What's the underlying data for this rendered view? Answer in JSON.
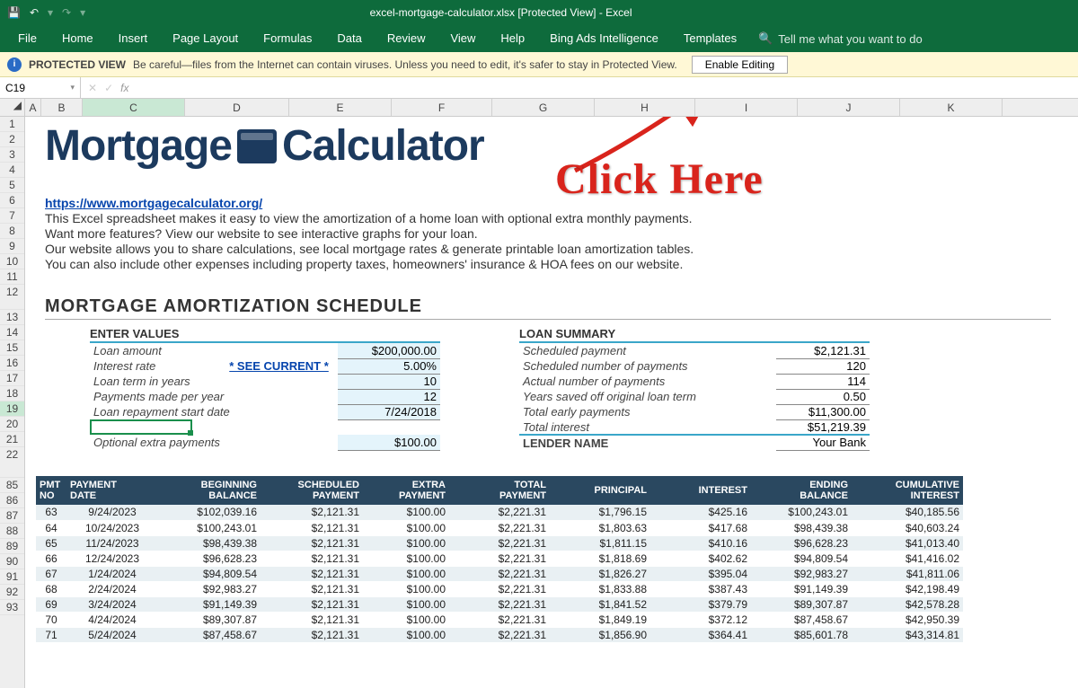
{
  "title": "excel-mortgage-calculator.xlsx  [Protected View]  -  Excel",
  "qat": {
    "save": "💾",
    "undo": "↶",
    "redo": "↷"
  },
  "ribbon": [
    "File",
    "Home",
    "Insert",
    "Page Layout",
    "Formulas",
    "Data",
    "Review",
    "View",
    "Help",
    "Bing Ads Intelligence",
    "Templates"
  ],
  "tell_me": "Tell me what you want to do",
  "protected": {
    "label": "PROTECTED VIEW",
    "msg": "Be careful—files from the Internet can contain viruses. Unless you need to edit, it's safer to stay in Protected View.",
    "button": "Enable Editing"
  },
  "namebox": "C19",
  "cols": [
    "A",
    "B",
    "C",
    "D",
    "E",
    "F",
    "G",
    "H",
    "I",
    "J",
    "K"
  ],
  "rows_top": [
    "1",
    "2",
    "3",
    "4",
    "5",
    "6",
    "7",
    "8",
    "9",
    "10",
    "11"
  ],
  "row12": "12",
  "row13": "13",
  "rows_mid": [
    "14",
    "15",
    "16",
    "17",
    "18",
    "19",
    "20",
    "21"
  ],
  "row22": "22",
  "rows_bot": [
    "85",
    "86",
    "87",
    "88",
    "89",
    "90",
    "91",
    "92",
    "93"
  ],
  "logo_left": "Mortgage",
  "logo_right": "Calculator",
  "intro": {
    "url": "https://www.mortgagecalculator.org/",
    "l1": "This Excel spreadsheet makes it easy to view the amortization of a home loan with optional extra monthly payments.",
    "l2": "Want more features? View our website to see interactive graphs for your loan.",
    "l3": "Our website allows you to share calculations, see local mortgage rates & generate printable loan amortization tables.",
    "l4": "You can also include other expenses including property taxes, homeowners' insurance & HOA fees on our website."
  },
  "section": "MORTGAGE AMORTIZATION SCHEDULE",
  "enter": {
    "head": "ENTER VALUES",
    "rows": [
      {
        "label": "Loan amount",
        "val": "$200,000.00",
        "inp": true
      },
      {
        "label": "Interest rate",
        "link": "* SEE CURRENT *",
        "val": "5.00%",
        "inp": true
      },
      {
        "label": "Loan term in years",
        "val": "10",
        "inp": true
      },
      {
        "label": "Payments made per year",
        "val": "12",
        "inp": true
      },
      {
        "label": "Loan repayment start date",
        "val": "7/24/2018",
        "inp": true
      }
    ],
    "extra_label": "Optional extra payments",
    "extra_val": "$100.00"
  },
  "summary": {
    "head": "LOAN SUMMARY",
    "rows": [
      {
        "label": "Scheduled payment",
        "val": "$2,121.31"
      },
      {
        "label": "Scheduled number of payments",
        "val": "120"
      },
      {
        "label": "Actual number of payments",
        "val": "114"
      },
      {
        "label": "Years saved off original loan term",
        "val": "0.50"
      },
      {
        "label": "Total early payments",
        "val": "$11,300.00"
      },
      {
        "label": "Total interest",
        "val": "$51,219.39"
      }
    ],
    "lender_label": "LENDER NAME",
    "lender_val": "Your Bank"
  },
  "amort": {
    "headers": [
      "PMT NO",
      "PAYMENT DATE",
      "BEGINNING BALANCE",
      "SCHEDULED PAYMENT",
      "EXTRA PAYMENT",
      "TOTAL PAYMENT",
      "PRINCIPAL",
      "INTEREST",
      "ENDING BALANCE",
      "CUMULATIVE INTEREST"
    ],
    "rows": [
      [
        "63",
        "9/24/2023",
        "$102,039.16",
        "$2,121.31",
        "$100.00",
        "$2,221.31",
        "$1,796.15",
        "$425.16",
        "$100,243.01",
        "$40,185.56"
      ],
      [
        "64",
        "10/24/2023",
        "$100,243.01",
        "$2,121.31",
        "$100.00",
        "$2,221.31",
        "$1,803.63",
        "$417.68",
        "$98,439.38",
        "$40,603.24"
      ],
      [
        "65",
        "11/24/2023",
        "$98,439.38",
        "$2,121.31",
        "$100.00",
        "$2,221.31",
        "$1,811.15",
        "$410.16",
        "$96,628.23",
        "$41,013.40"
      ],
      [
        "66",
        "12/24/2023",
        "$96,628.23",
        "$2,121.31",
        "$100.00",
        "$2,221.31",
        "$1,818.69",
        "$402.62",
        "$94,809.54",
        "$41,416.02"
      ],
      [
        "67",
        "1/24/2024",
        "$94,809.54",
        "$2,121.31",
        "$100.00",
        "$2,221.31",
        "$1,826.27",
        "$395.04",
        "$92,983.27",
        "$41,811.06"
      ],
      [
        "68",
        "2/24/2024",
        "$92,983.27",
        "$2,121.31",
        "$100.00",
        "$2,221.31",
        "$1,833.88",
        "$387.43",
        "$91,149.39",
        "$42,198.49"
      ],
      [
        "69",
        "3/24/2024",
        "$91,149.39",
        "$2,121.31",
        "$100.00",
        "$2,221.31",
        "$1,841.52",
        "$379.79",
        "$89,307.87",
        "$42,578.28"
      ],
      [
        "70",
        "4/24/2024",
        "$89,307.87",
        "$2,121.31",
        "$100.00",
        "$2,221.31",
        "$1,849.19",
        "$372.12",
        "$87,458.67",
        "$42,950.39"
      ],
      [
        "71",
        "5/24/2024",
        "$87,458.67",
        "$2,121.31",
        "$100.00",
        "$2,221.31",
        "$1,856.90",
        "$364.41",
        "$85,601.78",
        "$43,314.81"
      ]
    ]
  },
  "annotation": "Click Here",
  "chart_data": {
    "type": "table",
    "title": "Mortgage Amortization Schedule",
    "columns": [
      "PMT NO",
      "PAYMENT DATE",
      "BEGINNING BALANCE",
      "SCHEDULED PAYMENT",
      "EXTRA PAYMENT",
      "TOTAL PAYMENT",
      "PRINCIPAL",
      "INTEREST",
      "ENDING BALANCE",
      "CUMULATIVE INTEREST"
    ],
    "rows": [
      [
        63,
        "9/24/2023",
        102039.16,
        2121.31,
        100.0,
        2221.31,
        1796.15,
        425.16,
        100243.01,
        40185.56
      ],
      [
        64,
        "10/24/2023",
        100243.01,
        2121.31,
        100.0,
        2221.31,
        1803.63,
        417.68,
        98439.38,
        40603.24
      ],
      [
        65,
        "11/24/2023",
        98439.38,
        2121.31,
        100.0,
        2221.31,
        1811.15,
        410.16,
        96628.23,
        41013.4
      ],
      [
        66,
        "12/24/2023",
        96628.23,
        2121.31,
        100.0,
        2221.31,
        1818.69,
        402.62,
        94809.54,
        41416.02
      ],
      [
        67,
        "1/24/2024",
        94809.54,
        2121.31,
        100.0,
        2221.31,
        1826.27,
        395.04,
        92983.27,
        41811.06
      ],
      [
        68,
        "2/24/2024",
        92983.27,
        2121.31,
        100.0,
        2221.31,
        1833.88,
        387.43,
        91149.39,
        42198.49
      ],
      [
        69,
        "3/24/2024",
        91149.39,
        2121.31,
        100.0,
        2221.31,
        1841.52,
        379.79,
        89307.87,
        42578.28
      ],
      [
        70,
        "4/24/2024",
        89307.87,
        2121.31,
        100.0,
        2221.31,
        1849.19,
        372.12,
        87458.67,
        42950.39
      ],
      [
        71,
        "5/24/2024",
        87458.67,
        2121.31,
        100.0,
        2221.31,
        1856.9,
        364.41,
        85601.78,
        43314.81
      ]
    ]
  }
}
